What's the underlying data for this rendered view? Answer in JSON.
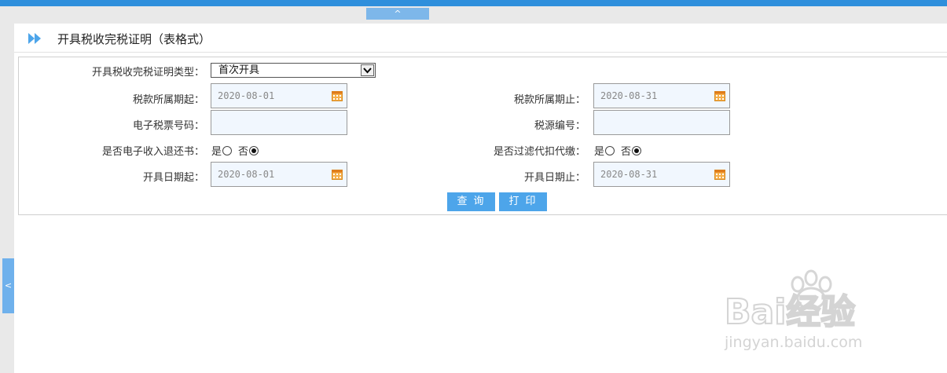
{
  "top_bar": {
    "collapse_label": "^"
  },
  "side_tab": {
    "label": "<"
  },
  "header": {
    "title": "开具税收完税证明（表格式）"
  },
  "form": {
    "type_label": "开具税收完税证明类型：",
    "type_value": "首次开具",
    "tax_period_start_label": "税款所属期起：",
    "tax_period_start_value": "2020-08-01",
    "tax_period_end_label": "税款所属期止：",
    "tax_period_end_value": "2020-08-31",
    "e_ticket_label": "电子税票号码：",
    "e_ticket_value": "",
    "tax_source_label": "税源编号：",
    "tax_source_value": "",
    "refund_label": "是否电子收入退还书：",
    "filter_label": "是否过滤代扣代缴：",
    "yes_label": "是",
    "no_label": "否",
    "refund_selected": "否",
    "filter_selected": "否",
    "issue_date_start_label": "开具日期起：",
    "issue_date_start_value": "2020-08-01",
    "issue_date_end_label": "开具日期止：",
    "issue_date_end_value": "2020-08-31"
  },
  "buttons": {
    "query": "查询",
    "print": "打印"
  },
  "watermark": {
    "brand": "Bai经验",
    "url": "jingyan.baidu.com"
  },
  "colors": {
    "accent": "#4da5ea",
    "top_strip": "#2f8fdc",
    "field_bg": "#f1f7fe",
    "calendar": "#f0a030"
  }
}
